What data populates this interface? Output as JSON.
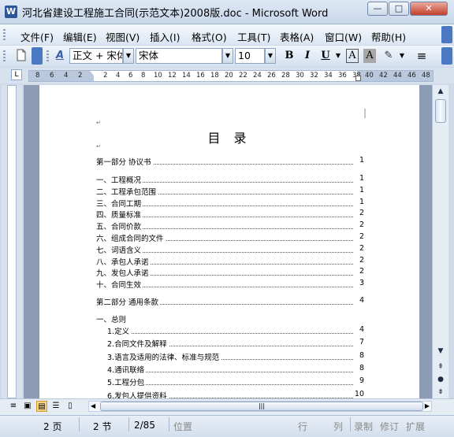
{
  "window": {
    "app_icon": "W",
    "title": "河北省建设工程施工合同(示范文本)2008版.doc - Microsoft Word",
    "minimize_glyph": "—",
    "maximize_glyph": "□",
    "close_glyph": "✕"
  },
  "menu": {
    "items": [
      "文件(F)",
      "编辑(E)",
      "视图(V)",
      "插入(I)",
      "格式(O)",
      "工具(T)",
      "表格(A)",
      "窗口(W)",
      "帮助(H)"
    ]
  },
  "toolbar": {
    "new_icon": "new-document-icon",
    "styles_glyph": "A",
    "style_value": "正文 + 宋体",
    "font_value": "宋体",
    "size_value": "10",
    "bold": "B",
    "italic": "I",
    "underline": "U",
    "char_border": "A",
    "char_shading": "A",
    "highlight_glyph": "✎",
    "align_glyph": "≡"
  },
  "ruler": {
    "corner_glyph": "L",
    "labels": [
      "8",
      "6",
      "4",
      "2",
      "2",
      "4",
      "6",
      "8",
      "10",
      "12",
      "14",
      "16",
      "18",
      "20",
      "22",
      "24",
      "26",
      "28",
      "30",
      "32",
      "34",
      "36",
      "38",
      "40",
      "42",
      "44",
      "46",
      "48"
    ]
  },
  "document": {
    "toc_title": "目 录",
    "part1": {
      "text": "第一部分    协议书",
      "page": "1"
    },
    "part1_items": [
      {
        "text": "一、工程概况",
        "page": "1"
      },
      {
        "text": "二、工程承包范围",
        "page": "1"
      },
      {
        "text": "三、合同工期",
        "page": "1"
      },
      {
        "text": "四、质量标准",
        "page": "2"
      },
      {
        "text": "五、合同价款",
        "page": "2"
      },
      {
        "text": "六、组成合同的文件",
        "page": "2"
      },
      {
        "text": "七、词语含义",
        "page": "2"
      },
      {
        "text": "八、承包人承诺",
        "page": "2"
      },
      {
        "text": "九、发包人承诺",
        "page": "2"
      },
      {
        "text": "十、合同生效",
        "page": "3"
      }
    ],
    "part2": {
      "text": "第二部分    通用条款",
      "page": "4"
    },
    "general": "一、总则",
    "part2_items": [
      {
        "text": "1.定义",
        "page": "4"
      },
      {
        "text": "2.合同文件及解释",
        "page": "7"
      },
      {
        "text": "3.语言及适用的法律、标准与规范",
        "page": "8"
      },
      {
        "text": "4.通讯联络",
        "page": "8"
      },
      {
        "text": "5.工程分包",
        "page": "9"
      },
      {
        "text": "6.发包人提供资料",
        "page": "10"
      }
    ]
  },
  "scroll": {
    "up": "▲",
    "down": "▼",
    "prev_page": "⇞",
    "select_browse": "●",
    "next_page": "⇟",
    "left": "◀",
    "right": "▶",
    "thumb_grip": "|||"
  },
  "status": {
    "page": "2 页",
    "section": "2 节",
    "page_of": "2/85",
    "position": "位置",
    "line": "行",
    "column": "列",
    "record": "录制",
    "revise": "修订",
    "extend": "扩展"
  },
  "colors": {
    "accent": "#4a78c2",
    "page": "#ffffff",
    "workspace": "#8c9cb4"
  }
}
